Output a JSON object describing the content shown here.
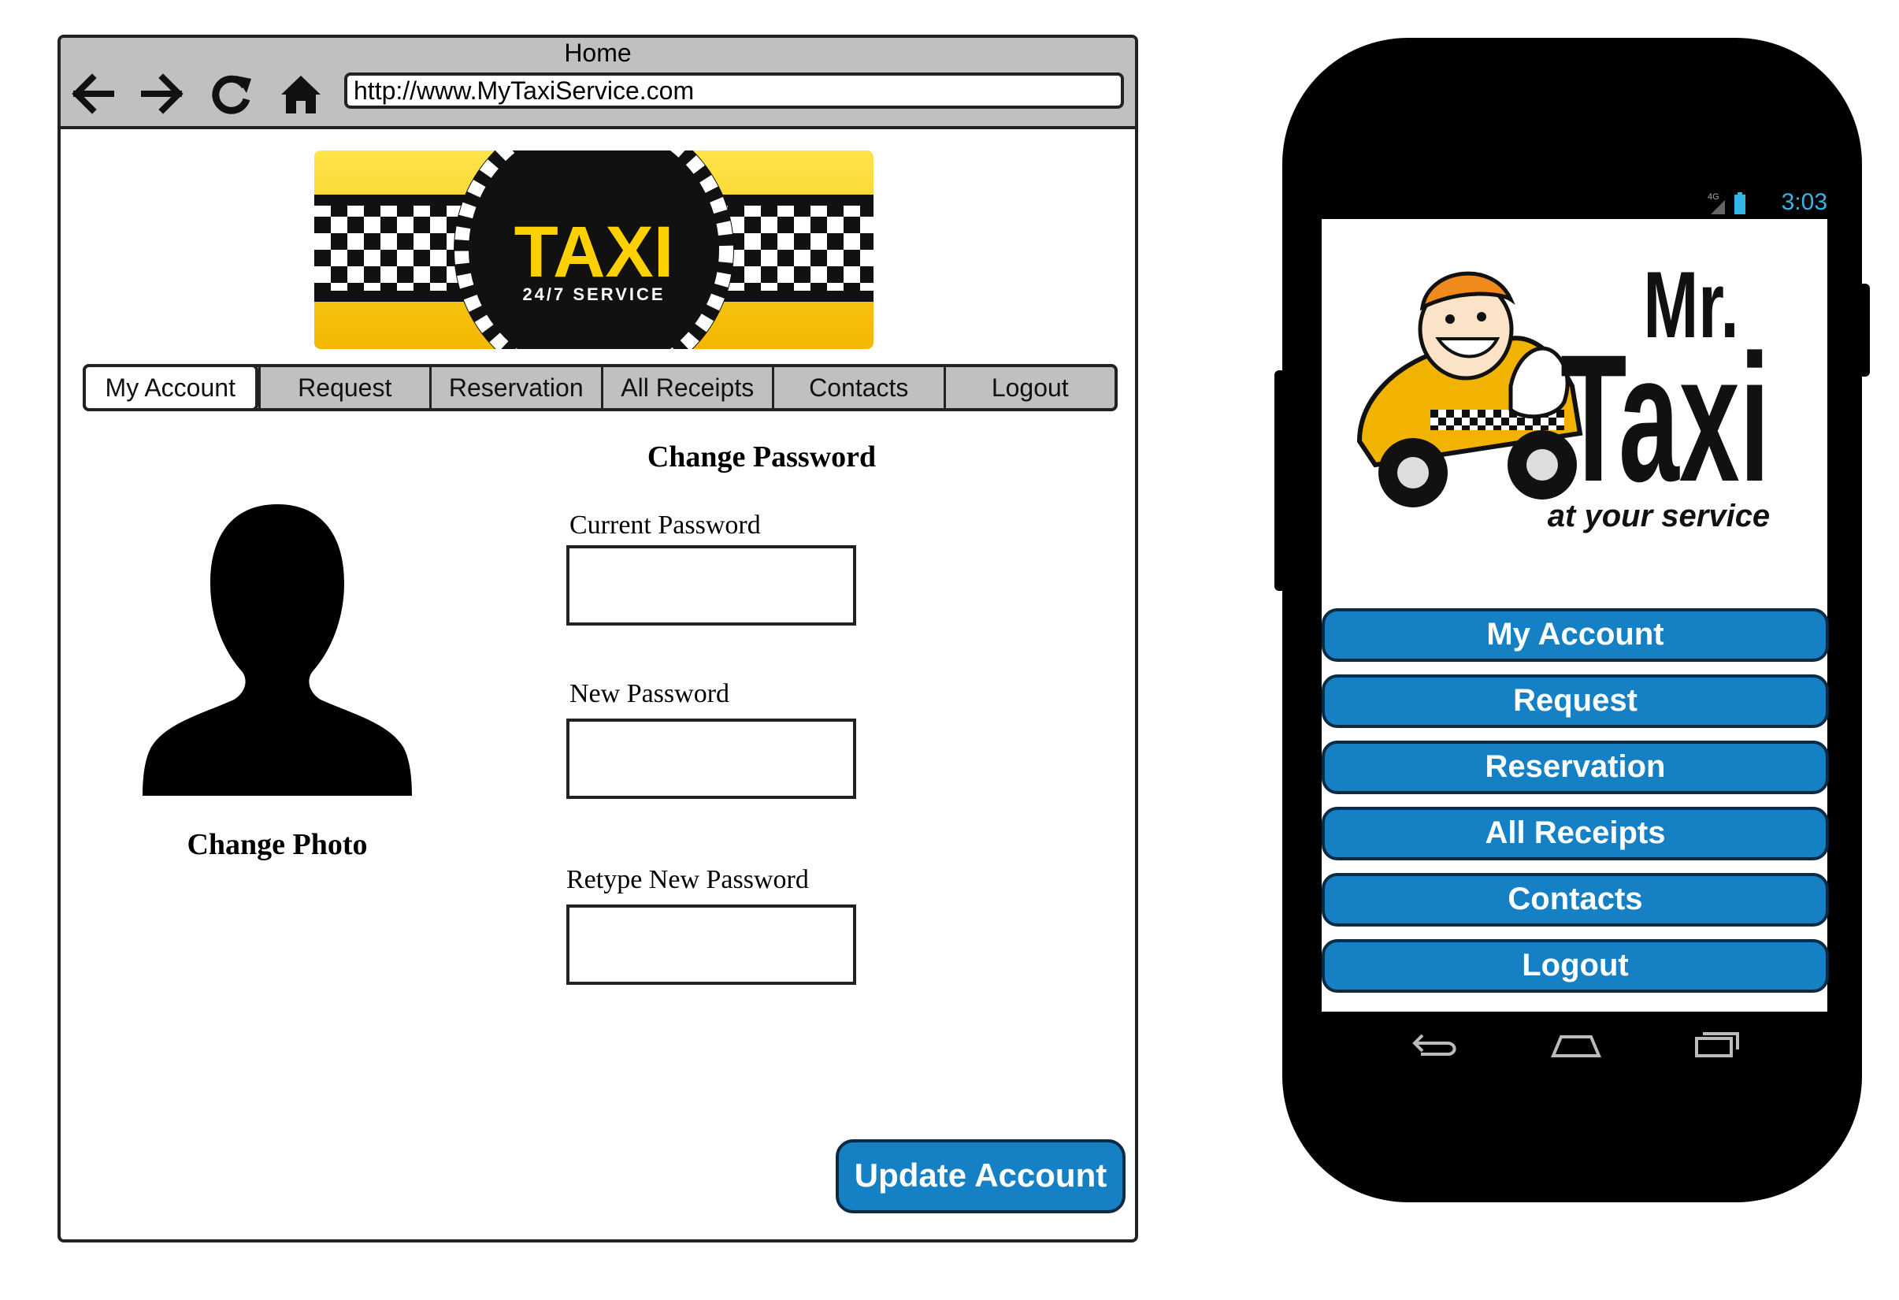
{
  "browser": {
    "window_title": "Home",
    "url": "http://www.MyTaxiService.com",
    "nav_icons": [
      "back-arrow-icon",
      "forward-arrow-icon",
      "reload-icon",
      "home-icon"
    ]
  },
  "logo": {
    "main_text": "TAXI",
    "sub_text": "24/7 SERVICE",
    "colors": {
      "yellow": "#ffd000",
      "black": "#111111"
    }
  },
  "tabs": [
    {
      "label": "My Account",
      "active": true
    },
    {
      "label": "Request",
      "active": false
    },
    {
      "label": "Reservation",
      "active": false
    },
    {
      "label": "All Receipts",
      "active": false
    },
    {
      "label": "Contacts",
      "active": false
    },
    {
      "label": "Logout",
      "active": false
    }
  ],
  "profile": {
    "change_photo_label": "Change Photo"
  },
  "password_form": {
    "title": "Change Password",
    "fields": [
      {
        "label": "Current Password",
        "value": ""
      },
      {
        "label": "New Password",
        "value": ""
      },
      {
        "label": "Retype New Password",
        "value": ""
      }
    ],
    "submit_label": "Update Account"
  },
  "phone": {
    "status_time": "3:03",
    "status_network": "4G",
    "logo": {
      "line1": "Mr.",
      "line2": "Taxi",
      "tagline": "at your service"
    },
    "menu": [
      "My Account",
      "Request",
      "Reservation",
      "All Receipts",
      "Contacts",
      "Logout"
    ],
    "soft_keys": [
      "back-icon",
      "home-icon",
      "recent-apps-icon"
    ]
  },
  "colors": {
    "button_blue": "#1580c4",
    "button_border": "#0b2a44",
    "chrome_gray": "#c0c0c0",
    "status_cyan": "#33b5e5"
  }
}
